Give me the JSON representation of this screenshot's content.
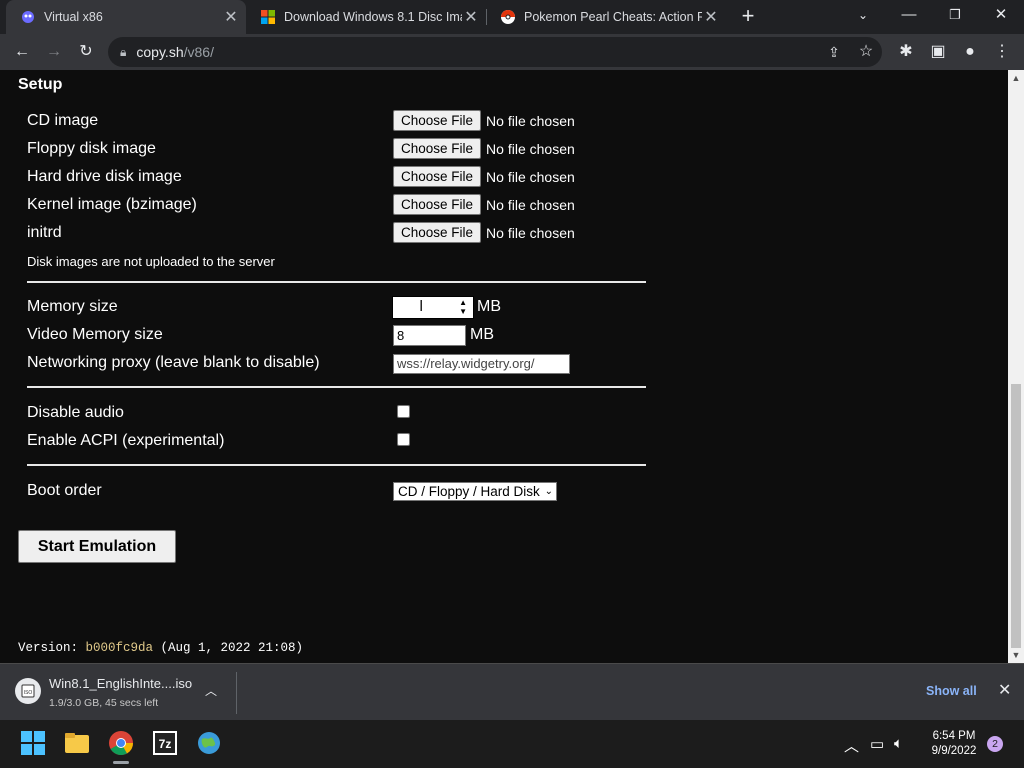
{
  "tabs": [
    {
      "title": "Virtual x86"
    },
    {
      "title": "Download Windows 8.1 Disc Ima"
    },
    {
      "title": "Pokemon Pearl Cheats: Action Re"
    }
  ],
  "address": {
    "host": "copy.sh",
    "path": "/v86/"
  },
  "setup": {
    "heading": "Setup",
    "files": [
      {
        "label": "CD image",
        "button": "Choose File",
        "status": "No file chosen"
      },
      {
        "label": "Floppy disk image",
        "button": "Choose File",
        "status": "No file chosen"
      },
      {
        "label": "Hard drive disk image",
        "button": "Choose File",
        "status": "No file chosen"
      },
      {
        "label": "Kernel image (bzimage)",
        "button": "Choose File",
        "status": "No file chosen"
      },
      {
        "label": "initrd",
        "button": "Choose File",
        "status": "No file chosen"
      }
    ],
    "note": "Disk images are not uploaded to the server",
    "memory": {
      "label": "Memory size",
      "value": "",
      "unit": "MB"
    },
    "video_memory": {
      "label": "Video Memory size",
      "value": "8",
      "unit": "MB"
    },
    "proxy": {
      "label": "Networking proxy (leave blank to disable)",
      "value": "wss://relay.widgetry.org/"
    },
    "disable_audio": {
      "label": "Disable audio",
      "checked": false
    },
    "acpi": {
      "label": "Enable ACPI (experimental)",
      "checked": false
    },
    "boot_order": {
      "label": "Boot order",
      "selected": "CD / Floppy / Hard Disk"
    },
    "start_button": "Start Emulation",
    "version_prefix": "Version: ",
    "version_hash": "b000fc9da",
    "version_date": " (Aug 1, 2022 21:08)"
  },
  "download": {
    "filename": "Win8.1_EnglishInte....iso",
    "status": "1.9/3.0 GB, 45 secs left",
    "show_all": "Show all"
  },
  "taskbar": {
    "time": "6:54 PM",
    "date": "9/9/2022",
    "notifications": "2"
  },
  "colors": {
    "page_bg": "#0d0d0d",
    "tab_bar": "#202124",
    "toolbar": "#35363a",
    "link": "#8ab4f8",
    "version_hash": "#e0c98a"
  }
}
